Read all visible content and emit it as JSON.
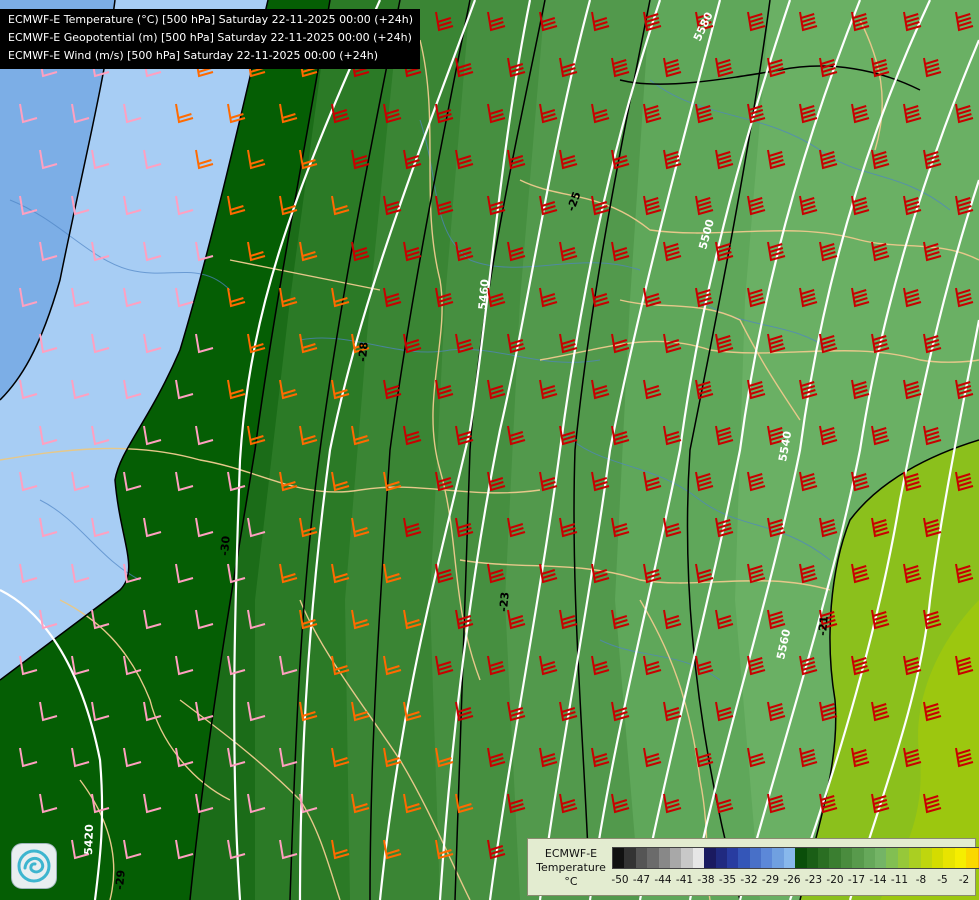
{
  "titles": [
    "ECMWF-E Temperature (°C) [500 hPa] Saturday 22-11-2025 00:00 (+24h)",
    "ECMWF-E Geopotential (m) [500 hPa] Saturday 22-11-2025 00:00 (+24h)",
    "ECMWF-E Wind (m/s) [500 hPa] Saturday 22-11-2025 00:00 (+24h)"
  ],
  "legend": {
    "line1": "ECMWF-E",
    "line2": "Temperature",
    "line3": "°C",
    "ticks": [
      "-50",
      "-47",
      "-44",
      "-41",
      "-38",
      "-35",
      "-32",
      "-29",
      "-26",
      "-23",
      "-20",
      "-17",
      "-14",
      "-11",
      "-8",
      "-5",
      "-2"
    ]
  },
  "geopotential_labels": [
    "5420",
    "5460",
    "5500",
    "5540",
    "5560",
    "5580"
  ],
  "temperature_labels": [
    "-30",
    "-28",
    "-25",
    "-23",
    "-21",
    "-29"
  ],
  "colors": {
    "temp_-32": "#78aee8",
    "temp_-30": "#aacff5",
    "temp_-29": "#005c00",
    "temp_-28": "#1a6e18",
    "temp_-27": "#2f7d2b",
    "temp_-26": "#3e8a39",
    "temp_-25": "#4c9646",
    "temp_-24": "#58a054",
    "temp_-23": "#64aa60",
    "temp_-22": "#70b26a",
    "temp_-21": "#88c000",
    "temp_-20": "#a6cc00",
    "wind_weak": "#ffa0c0",
    "wind_moderate": "#ff6a00",
    "wind_strong": "#c80000",
    "geopotential_contour": "#ffffff",
    "temperature_contour": "#000000",
    "borders": "#e6c88a",
    "rivers": "#4f84c4"
  },
  "logo_icon": "ecmwf-swirl-icon"
}
